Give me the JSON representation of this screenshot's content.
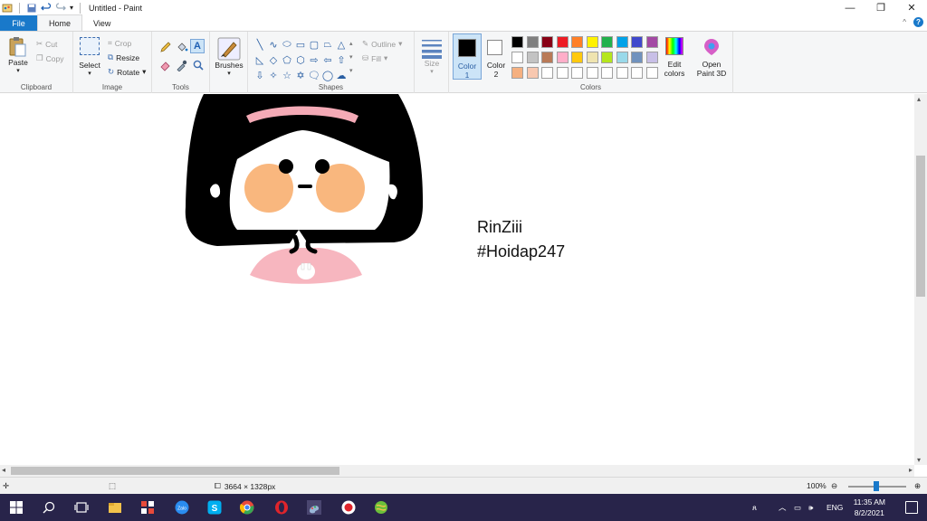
{
  "window": {
    "title": "Untitled - Paint",
    "minimize": "—",
    "restore": "❐",
    "close": "✕"
  },
  "tabs": {
    "file": "File",
    "home": "Home",
    "view": "View"
  },
  "ribbon": {
    "clipboard": {
      "label": "Clipboard",
      "paste": "Paste",
      "cut": "Cut",
      "copy": "Copy"
    },
    "image": {
      "label": "Image",
      "select": "Select",
      "crop": "Crop",
      "resize": "Resize",
      "rotate": "Rotate"
    },
    "tools": {
      "label": "Tools"
    },
    "brushes": {
      "label": "Brushes"
    },
    "shapes": {
      "label": "Shapes",
      "outline": "Outline",
      "fill": "Fill"
    },
    "size": {
      "label": "Size"
    },
    "colors": {
      "label": "Colors",
      "color1": "Color",
      "color1_num": "1",
      "color2": "Color",
      "color2_num": "2",
      "edit_colors_1": "Edit",
      "edit_colors_2": "colors",
      "paint3d_1": "Open",
      "paint3d_2": "Paint 3D",
      "palette_row1": [
        "#000000",
        "#7f7f7f",
        "#880015",
        "#ed1c24",
        "#ff7f27",
        "#fff200",
        "#22b14c",
        "#00a2e8",
        "#3f48cc",
        "#a349a4"
      ],
      "palette_row2": [
        "#ffffff",
        "#c3c3c3",
        "#b97a57",
        "#ffaec9",
        "#ffc90e",
        "#efe4b0",
        "#b5e61d",
        "#99d9ea",
        "#7092be",
        "#c8bfe7"
      ],
      "palette_row3": [
        "#f5b080",
        "#f8c8b0",
        "#ffffff",
        "#ffffff",
        "#ffffff",
        "#ffffff",
        "#ffffff",
        "#ffffff",
        "#ffffff",
        "#ffffff"
      ]
    }
  },
  "canvas": {
    "text_line1": "RinZiii",
    "text_line2": "#Hoidap247"
  },
  "status": {
    "dimensions": "3664 × 1328px",
    "zoom": "100%"
  },
  "taskbar": {
    "language": "ENG",
    "time": "11:35 AM",
    "date": "8/2/2021"
  }
}
